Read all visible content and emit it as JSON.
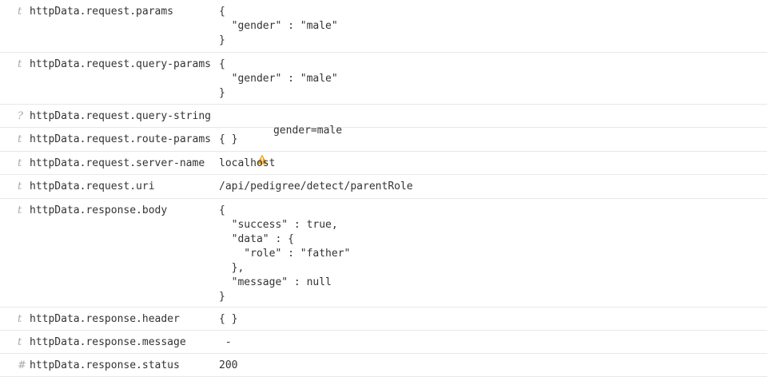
{
  "rows": [
    {
      "type": "t",
      "icon": "text-type-icon",
      "name": "httpData.request.params",
      "value": "{\n  \"gender\" : \"male\"\n}",
      "warning": false
    },
    {
      "type": "t",
      "icon": "text-type-icon",
      "name": "httpData.request.query-params",
      "value": "{\n  \"gender\" : \"male\"\n}",
      "warning": false
    },
    {
      "type": "?",
      "icon": "unknown-type-icon",
      "name": "httpData.request.query-string",
      "value": "gender=male",
      "warning": true
    },
    {
      "type": "t",
      "icon": "text-type-icon",
      "name": "httpData.request.route-params",
      "value": "{ }",
      "warning": false
    },
    {
      "type": "t",
      "icon": "text-type-icon",
      "name": "httpData.request.server-name",
      "value": "localhost",
      "warning": false
    },
    {
      "type": "t",
      "icon": "text-type-icon",
      "name": "httpData.request.uri",
      "value": "/api/pedigree/detect/parentRole",
      "warning": false
    },
    {
      "type": "t",
      "icon": "text-type-icon",
      "name": "httpData.response.body",
      "value": "{\n  \"success\" : true,\n  \"data\" : {\n    \"role\" : \"father\"\n  },\n  \"message\" : null\n}",
      "warning": false
    },
    {
      "type": "t",
      "icon": "text-type-icon",
      "name": "httpData.response.header",
      "value": "{ }",
      "warning": false
    },
    {
      "type": "t",
      "icon": "text-type-icon",
      "name": "httpData.response.message",
      "value": " -",
      "warning": false
    },
    {
      "type": "#",
      "icon": "number-type-icon",
      "name": "httpData.response.status",
      "value": "200",
      "warning": false
    }
  ],
  "colors": {
    "warning": "#f0a30a",
    "type_icon": "#a8a8a8",
    "text": "#333333",
    "divider": "#e8e8e8"
  }
}
